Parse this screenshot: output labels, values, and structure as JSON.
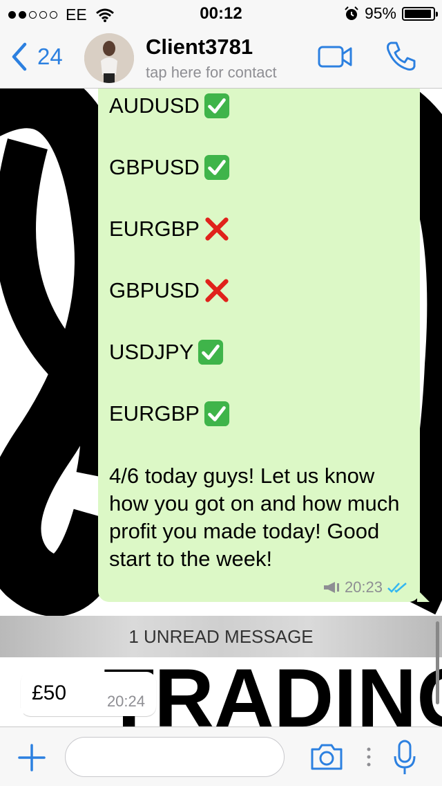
{
  "status_bar": {
    "carrier": "EE",
    "time": "00:12",
    "battery": "95%",
    "battery_level": 0.95
  },
  "nav": {
    "back_count": "24",
    "contact_name": "Client3781",
    "contact_subtitle": "tap here for contact"
  },
  "messages": {
    "outgoing": {
      "pairs": [
        {
          "label": "AUDUSD",
          "result": "check"
        },
        {
          "label": "GBPUSD",
          "result": "check"
        },
        {
          "label": "EURGBP",
          "result": "cross"
        },
        {
          "label": "GBPUSD",
          "result": "cross"
        },
        {
          "label": "USDJPY",
          "result": "check"
        },
        {
          "label": "EURGBP",
          "result": "check"
        }
      ],
      "text": "4/6 today guys! Let us know how you got on and how much profit you made today! Good start to the week!",
      "time": "20:23",
      "status": "read"
    },
    "unread_banner": "1 UNREAD MESSAGE",
    "incoming": {
      "text": "£50",
      "time": "20:24"
    }
  },
  "wallpaper_text": "TRADING",
  "composer": {
    "placeholder": ""
  },
  "colors": {
    "accent": "#2c80e0",
    "outgoing_bubble": "#dcf8c6",
    "check": "#3fb44a",
    "cross": "#e0221b"
  }
}
